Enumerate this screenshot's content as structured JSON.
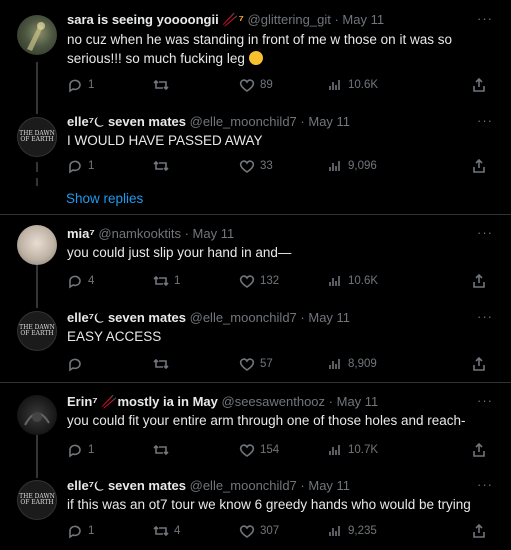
{
  "tweets": [
    {
      "name": "sara is seeing yoooongii",
      "name_extra": "🥢⁷",
      "handle": "@glittering_git",
      "date": "May 11",
      "text": "no cuz when he was standing in front of me w those on it was so serious!!! so much fucking leg",
      "reply": "1",
      "retweet": "",
      "like": "89",
      "views": "10.6K"
    },
    {
      "name": "elle⁷⏾ seven mates",
      "handle": "@elle_moonchild7",
      "date": "May 11",
      "text": "I WOULD HAVE PASSED AWAY",
      "reply": "1",
      "retweet": "",
      "like": "33",
      "views": "9,096"
    },
    {
      "name": "mia⁷",
      "handle": "@namkooktits",
      "date": "May 11",
      "text": "you could just slip your hand in and—",
      "reply": "4",
      "retweet": "1",
      "like": "132",
      "views": "10.6K"
    },
    {
      "name": "elle⁷⏾ seven mates",
      "handle": "@elle_moonchild7",
      "date": "May 11",
      "text": "EASY ACCESS",
      "reply": "",
      "retweet": "",
      "like": "57",
      "views": "8,909"
    },
    {
      "name": "Erin⁷ 🥢mostly ia in May",
      "handle": "@seesawenthooz",
      "date": "May 11",
      "text": "you could fit your entire arm through one of those holes and reach-",
      "reply": "1",
      "retweet": "",
      "like": "154",
      "views": "10.7K"
    },
    {
      "name": "elle⁷⏾ seven mates",
      "handle": "@elle_moonchild7",
      "date": "May 11",
      "text": "if this was an ot7 tour we know 6 greedy hands who would be trying",
      "reply": "1",
      "retweet": "4",
      "like": "307",
      "views": "9,235"
    }
  ],
  "show_replies": "Show replies",
  "avatar_text": "THE DAWN OF EARTH",
  "more": "···"
}
